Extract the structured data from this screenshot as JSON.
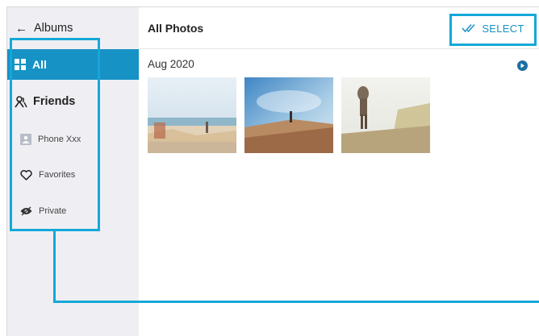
{
  "sidebar": {
    "back_label": "Albums",
    "items": [
      {
        "label": "All",
        "icon": "grid-icon"
      },
      {
        "label": "Friends",
        "icon": "people-icon"
      },
      {
        "label": "Phone Xxx",
        "icon": "phone-album-icon"
      },
      {
        "label": "Favorites",
        "icon": "heart-icon"
      },
      {
        "label": "Private",
        "icon": "eye-slash-icon"
      }
    ]
  },
  "main": {
    "title": "All Photos",
    "select_label": "SELECT",
    "group": {
      "date": "Aug 2020",
      "photos": [
        "beach-photo-1",
        "beach-photo-2",
        "beach-photo-3"
      ]
    }
  },
  "colors": {
    "accent": "#1792c4",
    "callout": "#14a8d9",
    "sidebar_bg": "#efeff3"
  }
}
